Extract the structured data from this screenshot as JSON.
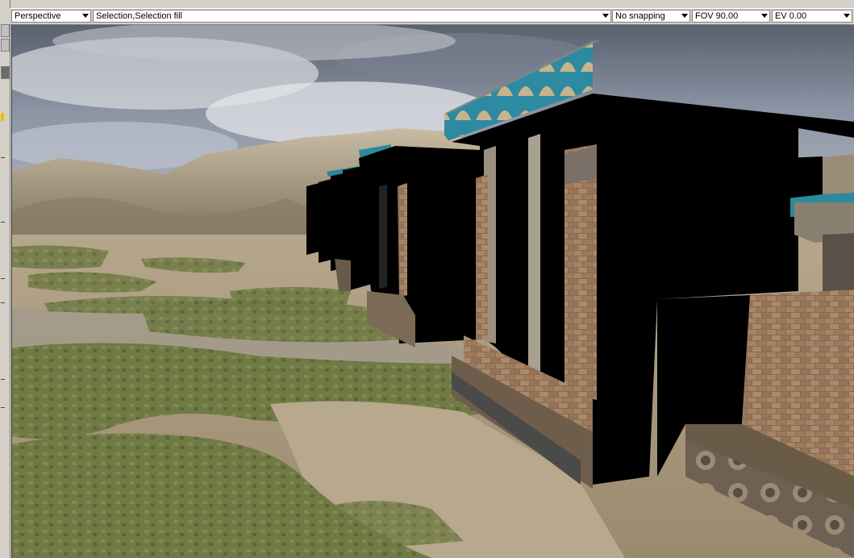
{
  "toolbar": {
    "view_mode": "Perspective",
    "selection_mode": "Selection,Selection fill",
    "snapping": "No snapping",
    "fov": "FOV 90.00",
    "ev": "EV  0.00"
  },
  "viewport": {
    "scene": "3d-terrain-with-ruined-temple-walls"
  }
}
